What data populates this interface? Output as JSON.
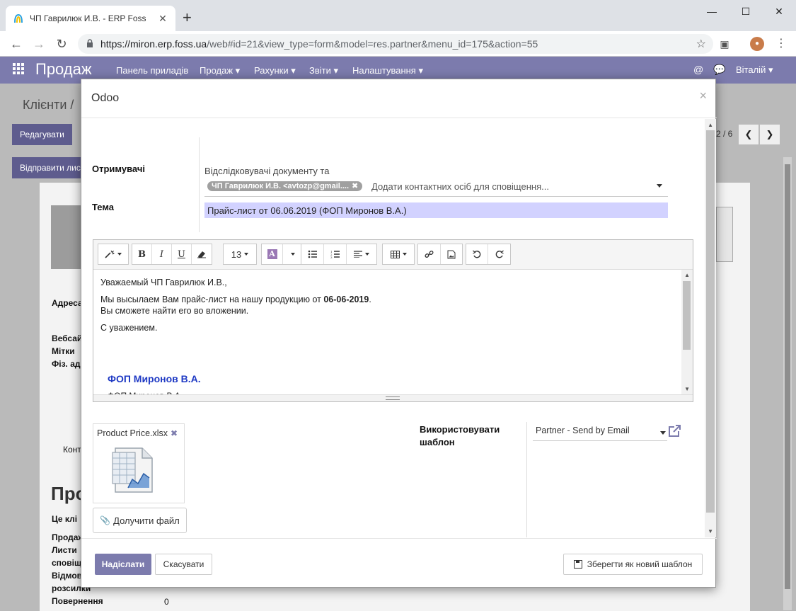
{
  "browser": {
    "tab_title": "ЧП Гаврилюк И.В. - ERP Foss",
    "tab_close": "✕",
    "new_tab": "+",
    "url_host": "https://miron.erp.foss.ua",
    "url_path": "/web#id=21&view_type=form&model=res.partner&menu_id=175&action=55",
    "win_minimize": "—",
    "win_maximize": "☐",
    "win_close": "✕"
  },
  "app_nav": {
    "brand": "Продаж",
    "menu": [
      "Панель приладів",
      "Продаж ▾",
      "Рахунки ▾",
      "Звіти ▾",
      "Налаштування ▾"
    ],
    "user": "Віталій ▾"
  },
  "background": {
    "breadcrumb": "Клієнти /",
    "edit_button": "Редагувати",
    "send_button": "Відправити лис",
    "pager": "2 / 6",
    "labels": {
      "address": "Адреса",
      "website": "Вебсай",
      "tags": "Мітки",
      "phys_addr": "Фіз. ад",
      "contacts_tab": "Конт",
      "big_heading": "Про",
      "is_client": "Це клі",
      "sales": "Продаж",
      "letters": "Листи",
      "notices": "сповіщ",
      "refusal": "Відмов",
      "mailings": "розсилки",
      "returns": "Повернення"
    },
    "returns_value": "0"
  },
  "modal": {
    "title": "Odoo",
    "close": "×",
    "recipients_label": "Отримувачі",
    "followers_text": "Відслідковувачі документу та",
    "recipient_tag": "ЧП Гаврилюк И.В. <avtozp@gmail....",
    "recipient_tag_remove": "✖",
    "recipients_placeholder": "Додати контактних осіб для сповіщення...",
    "subject_label": "Тема",
    "subject_value": "Прайс-лист от 06.06.2019 (ФОП Миронов В.А.)",
    "toolbar": {
      "font_size": "13",
      "bold": "B",
      "italic": "I",
      "underline": "U",
      "color_letter": "A"
    },
    "body": {
      "greeting": "Уважаемый ЧП Гаврилюк И.В.,",
      "line1_prefix": "Мы высылаем Вам прайс-лист на нашу продукцию от ",
      "line1_date": "06-06-2019",
      "line1_suffix": ".",
      "line2": "Вы сможете найти его во вложении.",
      "closing": "С уважением.",
      "signature_name": "ФОП Миронов В.А.",
      "signature_sub": "ФОП Миронов В.А."
    },
    "attachment": {
      "filename": "Product Price.xlsx",
      "remove": "✖"
    },
    "attach_button": "Долучити файл",
    "template_label": "Використовувати шаблон",
    "template_value": "Partner - Send by Email",
    "send_button": "Надіслати",
    "cancel_button": "Скасувати",
    "save_template_button": "Зберегти як новий шаблон"
  }
}
